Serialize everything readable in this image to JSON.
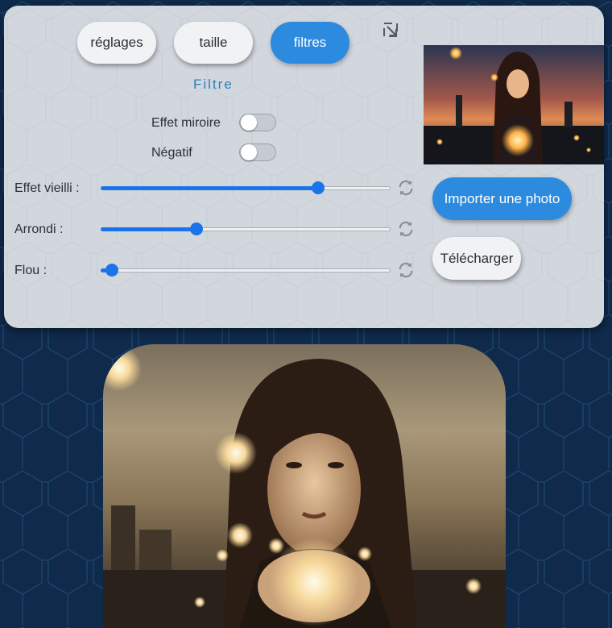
{
  "tabs": [
    {
      "label": "réglages",
      "active": false
    },
    {
      "label": "taille",
      "active": false
    },
    {
      "label": "filtres",
      "active": true
    }
  ],
  "section_title": "Filtre",
  "toggles": {
    "mirror": {
      "label": "Effet miroire",
      "on": false
    },
    "negative": {
      "label": "Négatif",
      "on": false
    }
  },
  "sliders": {
    "aging": {
      "label": "Effet vieilli :",
      "value": 0.75
    },
    "rounding": {
      "label": "Arrondi :",
      "value": 0.33
    },
    "blur": {
      "label": "Flou :",
      "value": 0.04
    }
  },
  "actions": {
    "import_label": "Importer une photo",
    "download_label": "Télécharger"
  },
  "icons": {
    "corner": "resize-arrow-icon",
    "reset": "refresh-icon"
  },
  "colors": {
    "accent": "#2c8bdf",
    "slider": "#1a73e8",
    "page_bg": "#0f2a4b",
    "panel_bg": "#d2d7de",
    "section_title": "#2b7fb8"
  }
}
